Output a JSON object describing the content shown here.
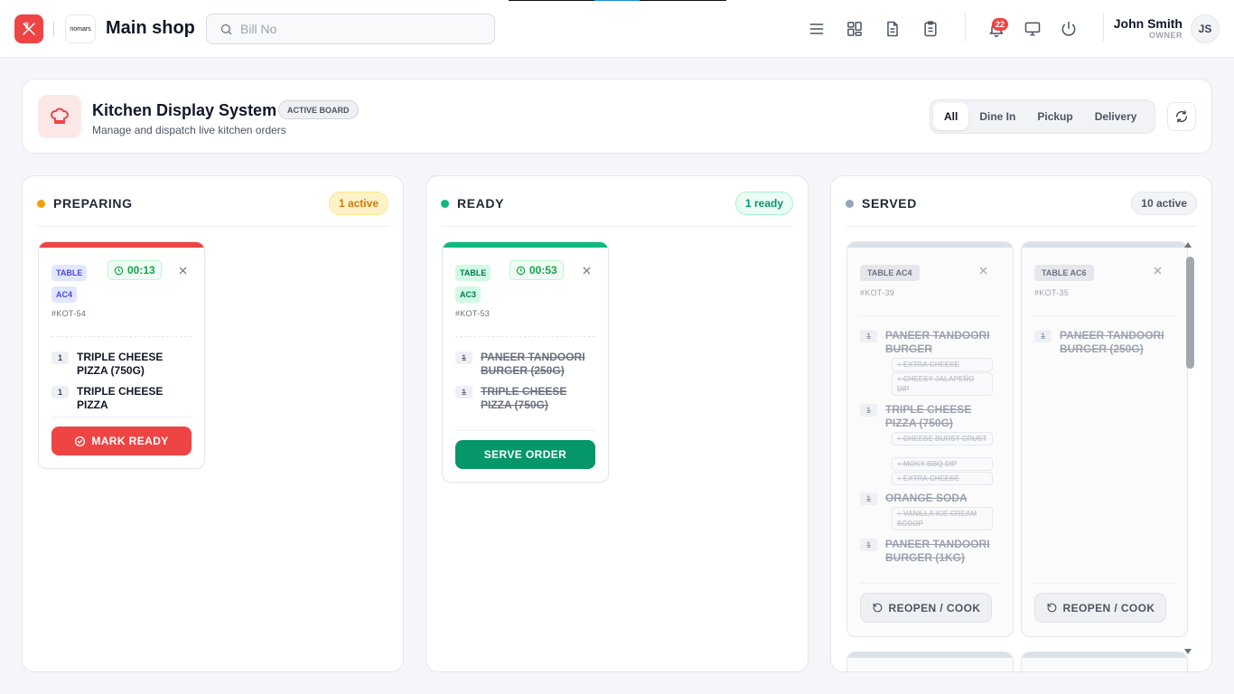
{
  "header": {
    "shop_logo_text": "nomars",
    "shop_name": "Main shop",
    "search_placeholder": "Bill No",
    "notification_count": "22",
    "user_name": "John Smith",
    "user_role": "OWNER",
    "user_initials": "JS",
    "icons": [
      "menu-icon",
      "grid-icon",
      "document-icon",
      "clipboard-icon",
      "bell-icon",
      "monitor-icon",
      "power-icon"
    ]
  },
  "kds": {
    "title": "Kitchen Display System",
    "badge": "ACTIVE BOARD",
    "subtitle": "Manage and dispatch live kitchen orders",
    "filters": [
      "All",
      "Dine In",
      "Pickup",
      "Delivery"
    ],
    "active_filter": "All"
  },
  "columns": {
    "preparing": {
      "title": "PREPARING",
      "pill": "1 active",
      "color": "#f59e0b",
      "orders": [
        {
          "table_line1": "TABLE",
          "table_line2": "AC4",
          "timer": "00:13",
          "kot": "#KOT-54",
          "items": [
            {
              "qty": "1",
              "name": "TRIPLE CHEESE PIZZA (750G)"
            },
            {
              "qty": "1",
              "name": "TRIPLE CHEESE PIZZA"
            }
          ],
          "action": "MARK READY"
        }
      ]
    },
    "ready": {
      "title": "READY",
      "pill": "1 ready",
      "color": "#10b981",
      "orders": [
        {
          "table_line1": "TABLE",
          "table_line2": "AC3",
          "timer": "00:53",
          "kot": "#KOT-53",
          "items": [
            {
              "qty": "1",
              "name": "PANEER TANDOORI BURGER (250G)"
            },
            {
              "qty": "1",
              "name": "TRIPLE CHEESE PIZZA (750G)"
            }
          ],
          "action": "SERVE ORDER"
        }
      ]
    },
    "served": {
      "title": "SERVED",
      "pill": "10 active",
      "color": "#94a3b8",
      "orders": [
        {
          "table": "TABLE AC4",
          "kot": "#KOT-39",
          "items": [
            {
              "qty": "1",
              "name": "PANEER TANDOORI BURGER",
              "addons": [
                "+ EXTRA CHEESE",
                "+ CHEESY JALAPEÑO DIP"
              ]
            },
            {
              "qty": "1",
              "name": "TRIPLE CHEESE PIZZA (750G)",
              "addons": [
                "+ CHEESE BURST CRUST",
                "+ MOKY BBQ DIP",
                "+ EXTRA CHEESE"
              ]
            },
            {
              "qty": "1",
              "name": "ORANGE SODA",
              "addons": [
                "+ VANILLA ICE-CREAM SCOOP"
              ]
            },
            {
              "qty": "1",
              "name": "PANEER TANDOORI BURGER (1KG)",
              "addons": []
            }
          ],
          "action": "REOPEN / COOK"
        },
        {
          "table": "TABLE AC6",
          "kot": "#KOT-35",
          "items": [
            {
              "qty": "1",
              "name": "PANEER TANDOORI BURGER (250G)",
              "addons": []
            }
          ],
          "action": "REOPEN / COOK"
        }
      ]
    }
  },
  "colors": {
    "brand_red": "#ef4444",
    "ready_green": "#059669",
    "served_grey": "#94a3b8"
  }
}
